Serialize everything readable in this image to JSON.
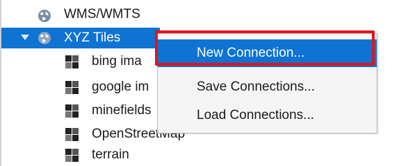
{
  "tree": {
    "items": [
      {
        "label": "WMS/WMTS",
        "icon": "globe-icon"
      },
      {
        "label": "XYZ Tiles",
        "icon": "globe-icon",
        "expanded": true,
        "selected": true
      },
      {
        "label": "bing ima",
        "icon": "xyz-tile-icon"
      },
      {
        "label": "google im",
        "icon": "xyz-tile-icon"
      },
      {
        "label": "minefields",
        "icon": "xyz-tile-icon"
      },
      {
        "label": "OpenStreetMap",
        "icon": "xyz-tile-icon"
      },
      {
        "label": "terrain",
        "icon": "xyz-tile-icon"
      }
    ]
  },
  "context_menu": {
    "items": [
      {
        "label": "New Connection...",
        "highlighted": true
      },
      {
        "label": "Save Connections..."
      },
      {
        "label": "Load Connections..."
      }
    ]
  },
  "colors": {
    "selection": "#0e73d2",
    "highlight_box": "#e3141b",
    "menu_bg": "#f5f5f5"
  }
}
